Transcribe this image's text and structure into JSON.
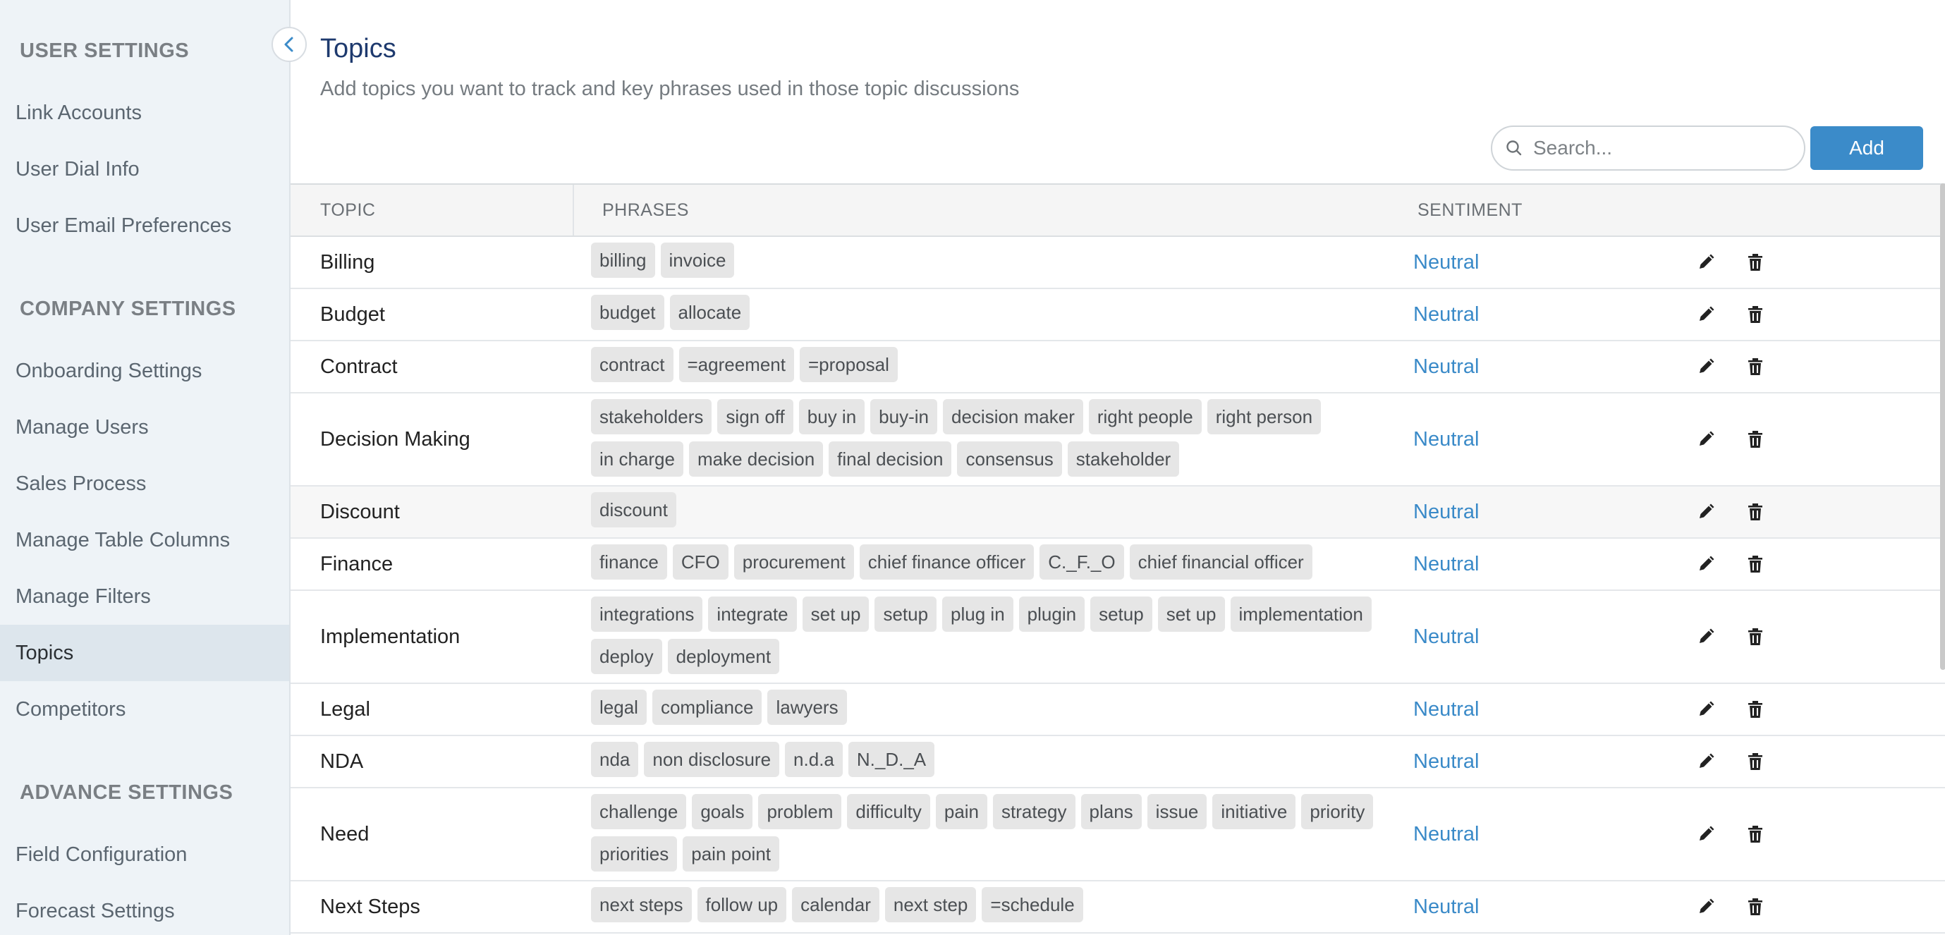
{
  "sidebar": {
    "sections": [
      {
        "heading": "USER SETTINGS",
        "items": [
          "Link Accounts",
          "User Dial Info",
          "User Email Preferences"
        ]
      },
      {
        "heading": "COMPANY SETTINGS",
        "items": [
          "Onboarding Settings",
          "Manage Users",
          "Sales Process",
          "Manage Table Columns",
          "Manage Filters",
          "Topics",
          "Competitors"
        ]
      },
      {
        "heading": "ADVANCE SETTINGS",
        "items": [
          "Field Configuration",
          "Forecast Settings"
        ]
      }
    ],
    "active_item": "Topics"
  },
  "header": {
    "title": "Topics",
    "subtitle": "Add topics you want to track and key phrases used in those topic discussions"
  },
  "search": {
    "placeholder": "Search..."
  },
  "add_label": "Add",
  "table": {
    "columns": [
      "TOPIC",
      "PHRASES",
      "SENTIMENT"
    ],
    "rows": [
      {
        "topic": "Billing",
        "phrases": [
          "billing",
          "invoice"
        ],
        "sentiment": "Neutral"
      },
      {
        "topic": "Budget",
        "phrases": [
          "budget",
          "allocate"
        ],
        "sentiment": "Neutral"
      },
      {
        "topic": "Contract",
        "phrases": [
          "contract",
          "=agreement",
          "=proposal"
        ],
        "sentiment": "Neutral"
      },
      {
        "topic": "Decision Making",
        "phrases": [
          "stakeholders",
          "sign off",
          "buy in",
          "buy-in",
          "decision maker",
          "right people",
          "right person",
          "in charge",
          "make decision",
          "final decision",
          "consensus",
          "stakeholder"
        ],
        "sentiment": "Neutral"
      },
      {
        "topic": "Discount",
        "phrases": [
          "discount"
        ],
        "sentiment": "Neutral",
        "highlighted": true
      },
      {
        "topic": "Finance",
        "phrases": [
          "finance",
          "CFO",
          "procurement",
          "chief finance officer",
          "C._F._O",
          "chief financial officer"
        ],
        "sentiment": "Neutral"
      },
      {
        "topic": "Implementation",
        "phrases": [
          "integrations",
          "integrate",
          "set up",
          "setup",
          "plug in",
          "plugin",
          "setup",
          "set up",
          "implementation",
          "deploy",
          "deployment"
        ],
        "sentiment": "Neutral"
      },
      {
        "topic": "Legal",
        "phrases": [
          "legal",
          "compliance",
          "lawyers"
        ],
        "sentiment": "Neutral"
      },
      {
        "topic": "NDA",
        "phrases": [
          "nda",
          "non disclosure",
          "n.d.a",
          "N._D._A"
        ],
        "sentiment": "Neutral"
      },
      {
        "topic": "Need",
        "phrases": [
          "challenge",
          "goals",
          "problem",
          "difficulty",
          "pain",
          "strategy",
          "plans",
          "issue",
          "initiative",
          "priority",
          "priorities",
          "pain point"
        ],
        "sentiment": "Neutral"
      },
      {
        "topic": "Next Steps",
        "phrases": [
          "next steps",
          "follow up",
          "calendar",
          "next step",
          "=schedule"
        ],
        "sentiment": "Neutral"
      }
    ]
  },
  "icons": {
    "collapse": "chevron-left-icon",
    "search": "search-icon",
    "edit": "pencil-icon",
    "delete": "trash-icon"
  },
  "colors": {
    "accent": "#3b8bc9",
    "title": "#1e3a6e",
    "sentiment": "#3a8ac8",
    "sidebar_bg": "#eef3f7",
    "chip_bg": "#e6e6e6"
  }
}
